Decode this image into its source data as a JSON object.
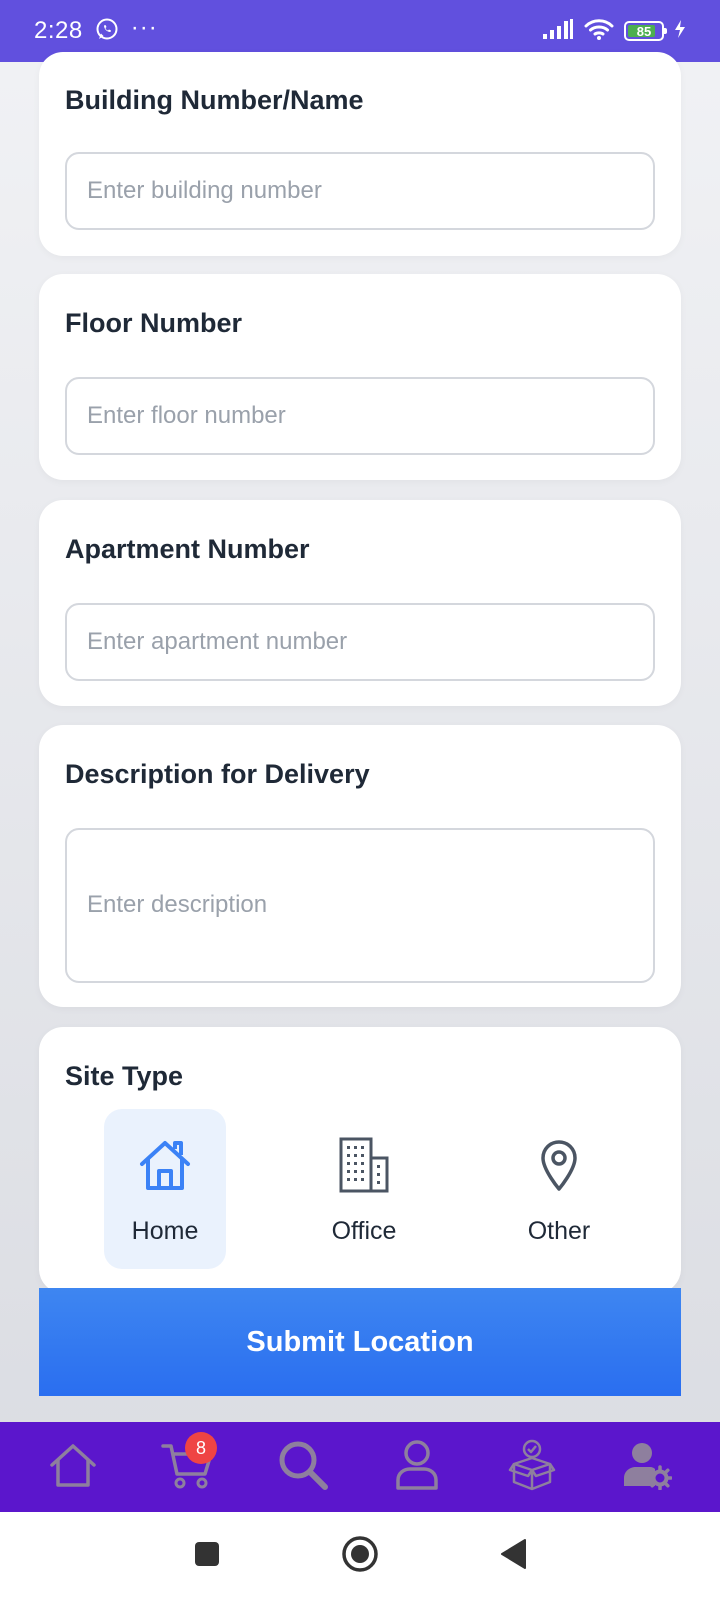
{
  "status_bar": {
    "time": "2:28",
    "more_dots": "···",
    "battery": "85",
    "battery_level": 0.85,
    "color": "#6150de"
  },
  "form": {
    "building": {
      "label": "Building Number/Name",
      "placeholder": "Enter building number",
      "value": ""
    },
    "floor": {
      "label": "Floor Number",
      "placeholder": "Enter floor number",
      "value": ""
    },
    "apartment": {
      "label": "Apartment Number",
      "placeholder": "Enter apartment number",
      "value": ""
    },
    "description": {
      "label": "Description for Delivery",
      "placeholder": "Enter description",
      "value": ""
    }
  },
  "site_type": {
    "label": "Site Type",
    "options": [
      {
        "label": "Home",
        "icon": "home-icon",
        "selected": true
      },
      {
        "label": "Office",
        "icon": "building-icon",
        "selected": false
      },
      {
        "label": "Other",
        "icon": "location-pin-icon",
        "selected": false
      }
    ]
  },
  "submit": {
    "label": "Submit Location",
    "color": "#3478f0"
  },
  "bottom_nav": {
    "color": "#5b16cc",
    "icon_color": "#8e7f9e",
    "cart_badge": "8",
    "items": [
      "home-icon",
      "cart-icon",
      "search-icon",
      "profile-icon",
      "orders-box-icon",
      "account-settings-icon"
    ]
  },
  "system_nav": {
    "items": [
      "recents-square-icon",
      "home-circle-icon",
      "back-triangle-icon"
    ]
  }
}
